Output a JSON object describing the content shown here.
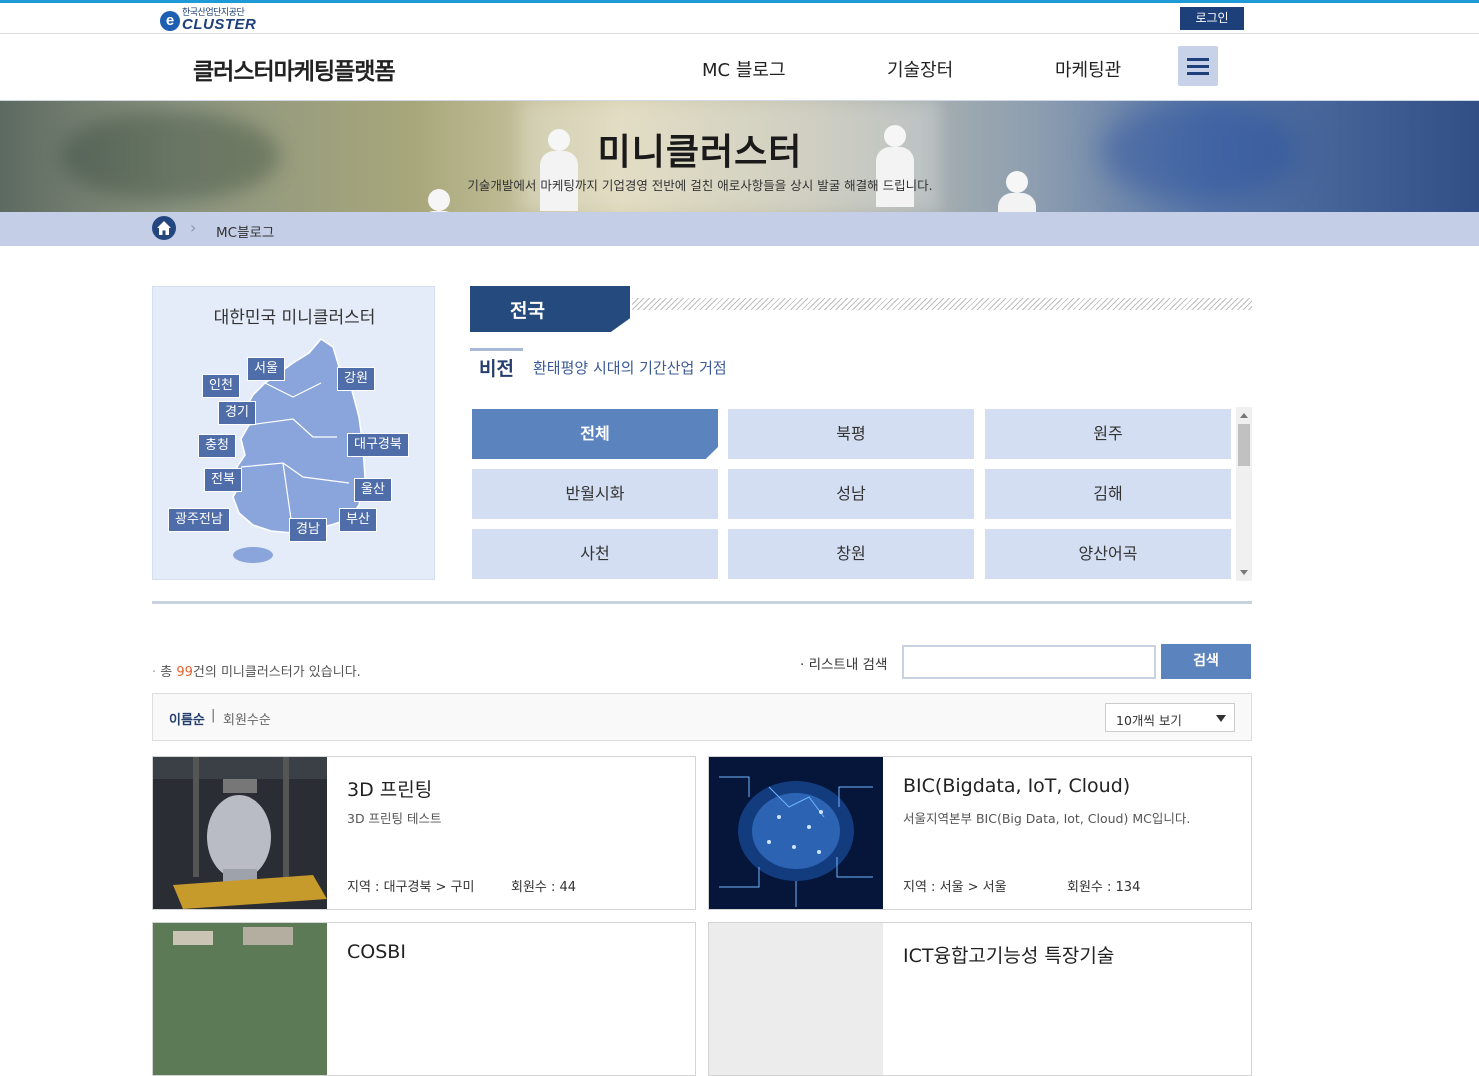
{
  "header": {
    "logo_small": "한국산업단지공단",
    "logo_text": "CLUSTER",
    "login_label": "로그인",
    "site_title": "클러스터마케팅플랫폼",
    "nav": [
      "MC 블로그",
      "기술장터",
      "마케팅관"
    ]
  },
  "banner": {
    "title": "미니클러스터",
    "subtitle": "기술개발에서 마케팅까지 기업경영 전반에 걸친 애로사항들을 상시 발굴 해결해 드립니다."
  },
  "breadcrumb": {
    "current": "MC블로그"
  },
  "map": {
    "title": "대한민국 미니클러스터",
    "regions": [
      "서울",
      "인천",
      "강원",
      "경기",
      "충청",
      "대구경북",
      "전북",
      "울산",
      "광주전남",
      "부산",
      "경남"
    ]
  },
  "section": {
    "tab_label": "전국",
    "vision_label": "비전",
    "vision_text": "환태평양 시대의 기간산업 거점"
  },
  "areas": [
    "전체",
    "북평",
    "원주",
    "반월시화",
    "성남",
    "김해",
    "사천",
    "창원",
    "양산어곡"
  ],
  "list": {
    "count_prefix": "총 ",
    "count_value": "99",
    "count_suffix": "건의 미니클러스터가 있습니다.",
    "search_label": "· 리스트내 검색",
    "search_value": "",
    "search_button": "검색",
    "sort_name": "이름순",
    "sort_sep": "|",
    "sort_member": "회원수순",
    "page_size": "10개씩 보기"
  },
  "cards": [
    {
      "title": "3D 프린팅",
      "desc": "3D 프린팅 테스트",
      "region": "지역 : 대구경북 > 구미",
      "members": "회원수 : 44"
    },
    {
      "title": "BIC(Bigdata, IoT, Cloud)",
      "desc": "서울지역본부 BIC(Big Data, Iot, Cloud) MC입니다.",
      "region": "지역 : 서울 > 서울",
      "members": "회원수 : 134"
    },
    {
      "title": "COSBI",
      "desc": "",
      "region": "",
      "members": ""
    },
    {
      "title": "ICT융합고기능성 특장기술",
      "desc": "",
      "region": "",
      "members": ""
    }
  ]
}
